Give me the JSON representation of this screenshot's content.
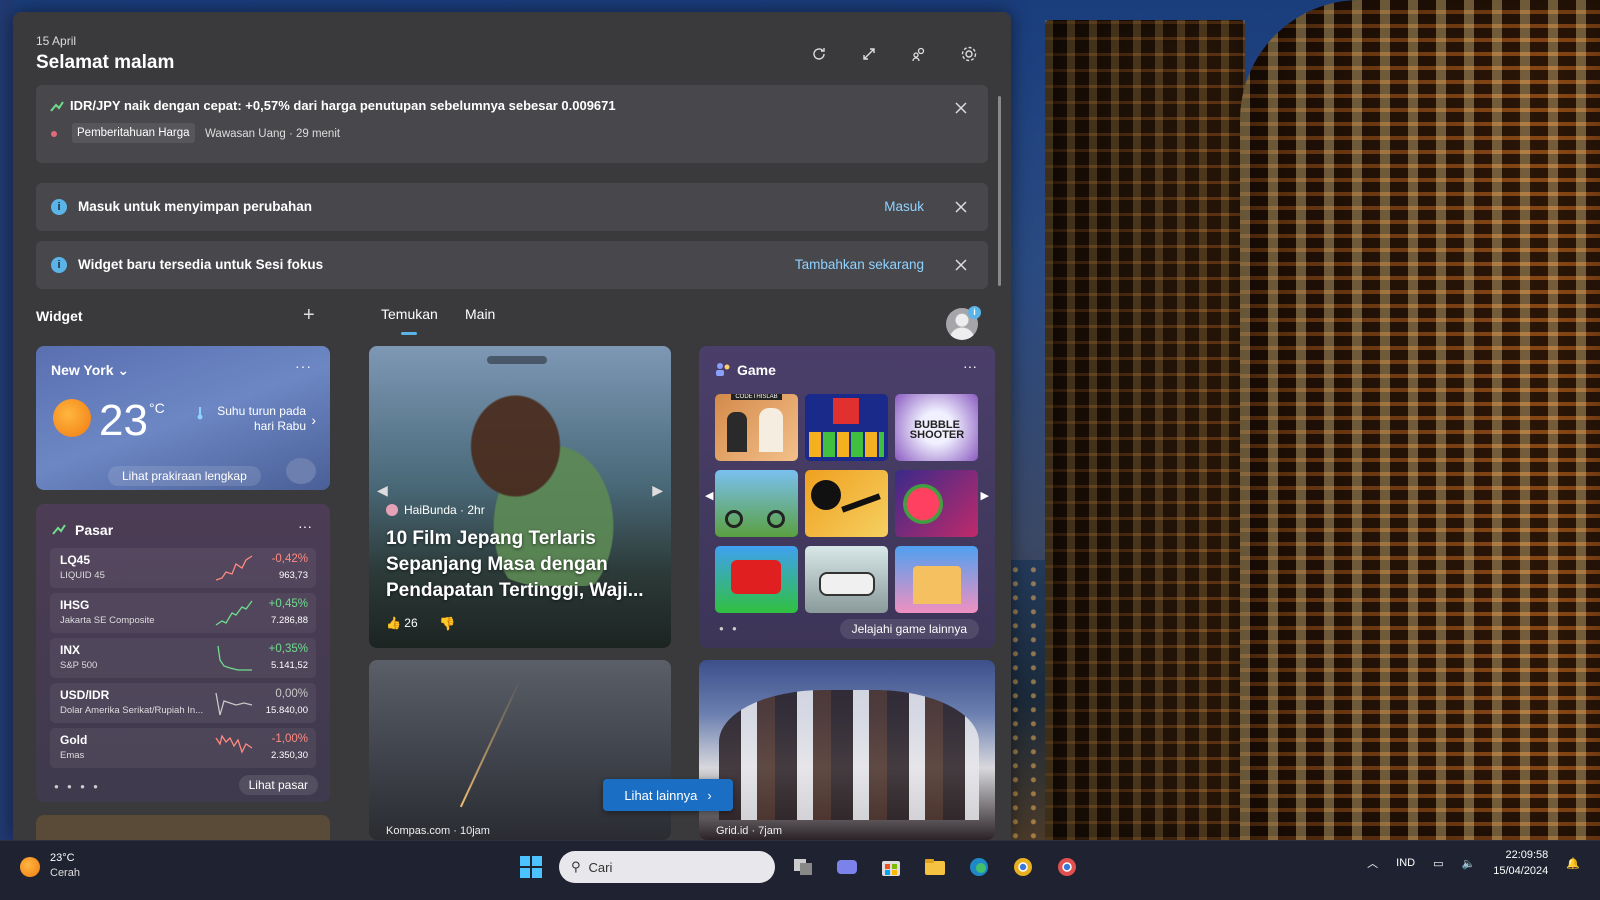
{
  "header": {
    "date": "15 April",
    "greeting": "Selamat malam"
  },
  "alert": {
    "title": "IDR/JPY naik dengan cepat: +0,57% dari harga penutupan sebelumnya sebesar 0.009671",
    "tag": "Pemberitahuan Harga",
    "source": "Wawasan Uang · 29 menit"
  },
  "notices": [
    {
      "text": "Masuk untuk menyimpan perubahan",
      "action": "Masuk"
    },
    {
      "text": "Widget baru tersedia untuk Sesi fokus",
      "action": "Tambahkan sekarang"
    }
  ],
  "widget_label": "Widget",
  "tabs": [
    "Temukan",
    "Main"
  ],
  "weather": {
    "city": "New York",
    "temp": "23",
    "unit": "°C",
    "forecast": "Suhu turun pada hari Rabu",
    "link": "Lihat prakiraan lengkap"
  },
  "market": {
    "title": "Pasar",
    "rows": [
      {
        "sym": "LQ45",
        "name": "LIQUID 45",
        "change": "-0,42%",
        "price": "963,73",
        "color": "#ff8a80"
      },
      {
        "sym": "IHSG",
        "name": "Jakarta SE Composite",
        "change": "+0,45%",
        "price": "7.286,88",
        "color": "#6fdc8c"
      },
      {
        "sym": "INX",
        "name": "S&P 500",
        "change": "+0,35%",
        "price": "5.141,52",
        "color": "#6fdc8c"
      },
      {
        "sym": "USD/IDR",
        "name": "Dolar Amerika Serikat/Rupiah In...",
        "change": "0,00%",
        "price": "15.840,00",
        "color": "#c8c8c8"
      },
      {
        "sym": "Gold",
        "name": "Emas",
        "change": "-1,00%",
        "price": "2.350,30",
        "color": "#ff8a80"
      }
    ],
    "link": "Lihat pasar"
  },
  "news": [
    {
      "source": "HaiBunda · 2hr",
      "headline": "10 Film Jepang Terlaris Sepanjang Masa dengan Pendapatan Tertinggi, Waji...",
      "likes": "26"
    },
    {
      "source": "Kompas.com · 10jam"
    },
    {
      "source": "Grid.id · 7jam"
    }
  ],
  "game": {
    "title": "Game",
    "link": "Jelajahi game lainnya",
    "tile1_label": "CODETHISLAB",
    "tile3_label": "BUBBLE SHOOTER"
  },
  "more_button": "Lihat lainnya",
  "taskbar": {
    "temp": "23°C",
    "condition": "Cerah",
    "search_placeholder": "Cari",
    "lang": "IND",
    "time": "22:09:58",
    "date": "15/04/2024"
  }
}
